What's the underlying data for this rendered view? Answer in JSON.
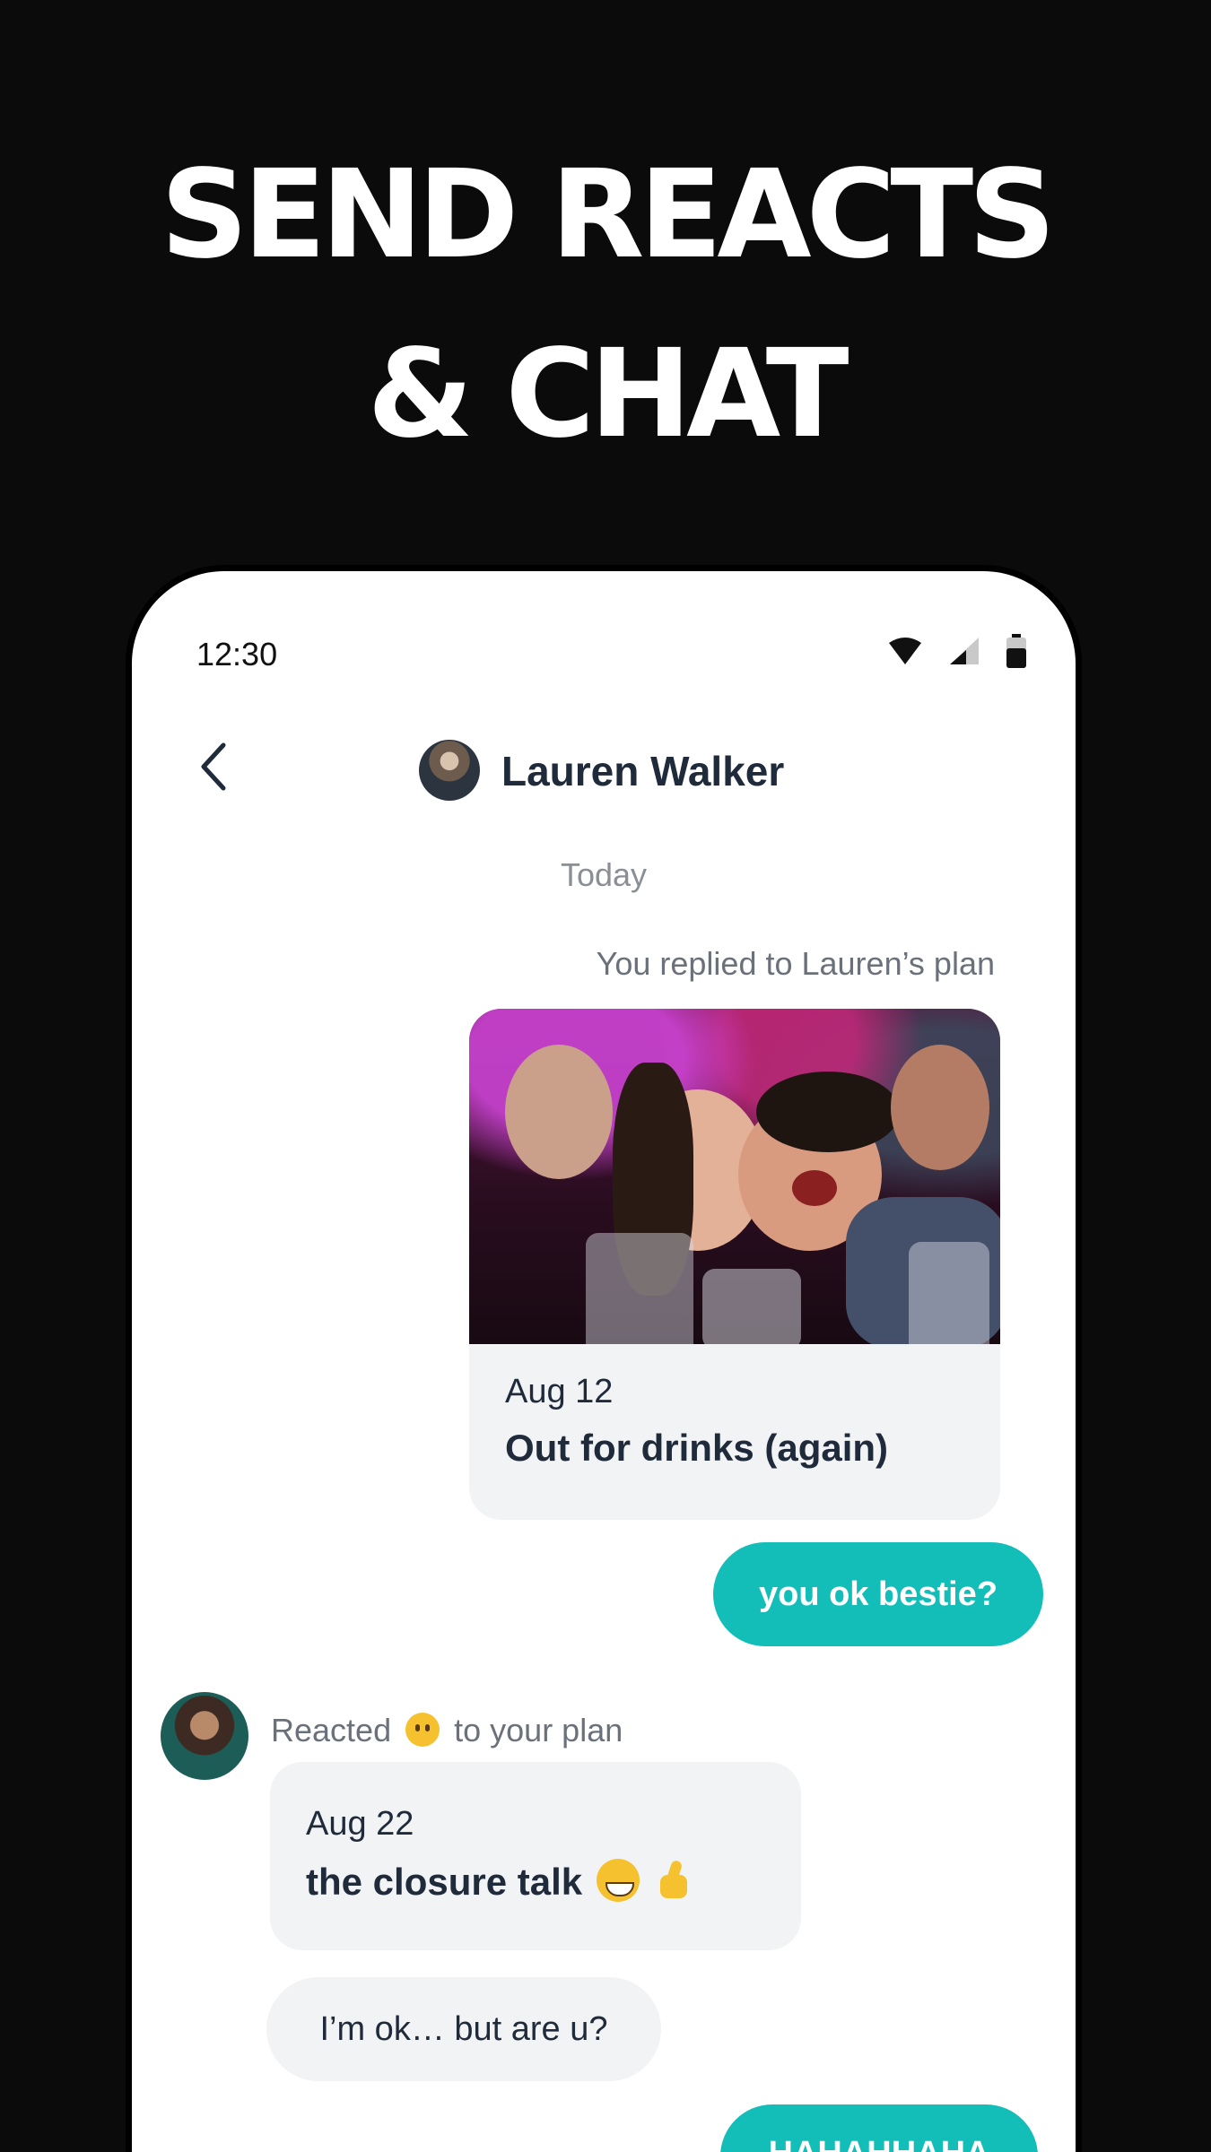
{
  "headline": {
    "line1": "SEND REACTS",
    "line2": "& CHAT"
  },
  "status": {
    "time": "12:30"
  },
  "header": {
    "contact_name": "Lauren Walker"
  },
  "chat": {
    "day_label": "Today",
    "reply_label": "You replied to Lauren’s plan",
    "plan": {
      "date": "Aug 12",
      "title": "Out for drinks (again)"
    },
    "message_out_1": "you ok bestie?",
    "react_prefix": "Reacted",
    "react_suffix": "to your plan",
    "react_plan": {
      "date": "Aug 22",
      "title": "the closure talk"
    },
    "message_in_1": "I’m ok… but are u?",
    "message_out_2": "HAHAHHAHA"
  },
  "icons": {
    "back": "chevron-left-icon",
    "wifi": "wifi-icon",
    "signal": "cell-signal-icon",
    "battery": "battery-icon"
  },
  "colors": {
    "accent": "#13bdb8",
    "background": "#0b0b0b",
    "text_dark": "#1f2a3a"
  }
}
